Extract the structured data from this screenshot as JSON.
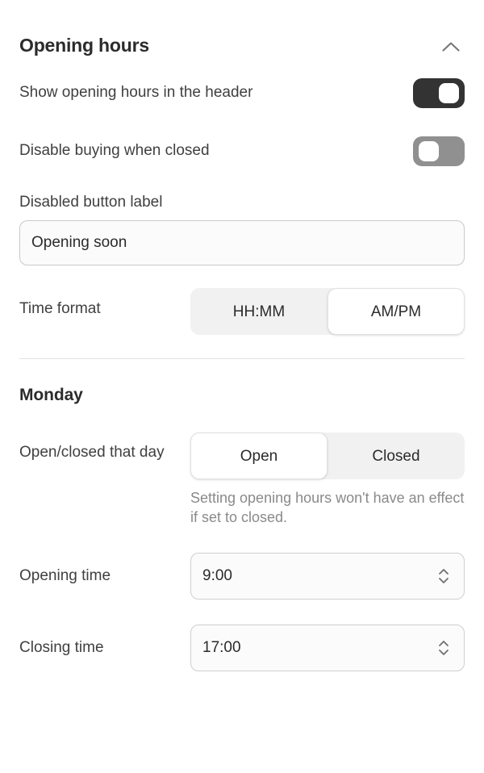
{
  "section": {
    "title": "Opening hours",
    "collapse_icon": "chevron-up-icon"
  },
  "settings": {
    "show_hours": {
      "label": "Show opening hours in the header",
      "state": "on"
    },
    "disable_buying": {
      "label": "Disable buying when closed",
      "state": "off"
    },
    "disabled_button": {
      "label": "Disabled button label",
      "value": "Opening soon",
      "placeholder": "Opening soon"
    },
    "time_format": {
      "label": "Time format",
      "options": [
        "HH:MM",
        "AM/PM"
      ],
      "selected": "AM/PM"
    }
  },
  "day": {
    "name": "Monday",
    "open_closed": {
      "label": "Open/closed that day",
      "options": [
        "Open",
        "Closed"
      ],
      "selected": "Open",
      "helper": "Setting opening hours won't have an effect if set to closed."
    },
    "opening_time": {
      "label": "Opening time",
      "value": "9:00"
    },
    "closing_time": {
      "label": "Closing time",
      "value": "17:00"
    }
  },
  "colors": {
    "toggle_on": "#333333",
    "toggle_off": "#909090",
    "text_primary": "#2b2b2b",
    "text_secondary": "#404040",
    "text_muted": "#8a8a8a",
    "segment_track": "#f1f1f1",
    "divider": "#e4e4e4"
  }
}
